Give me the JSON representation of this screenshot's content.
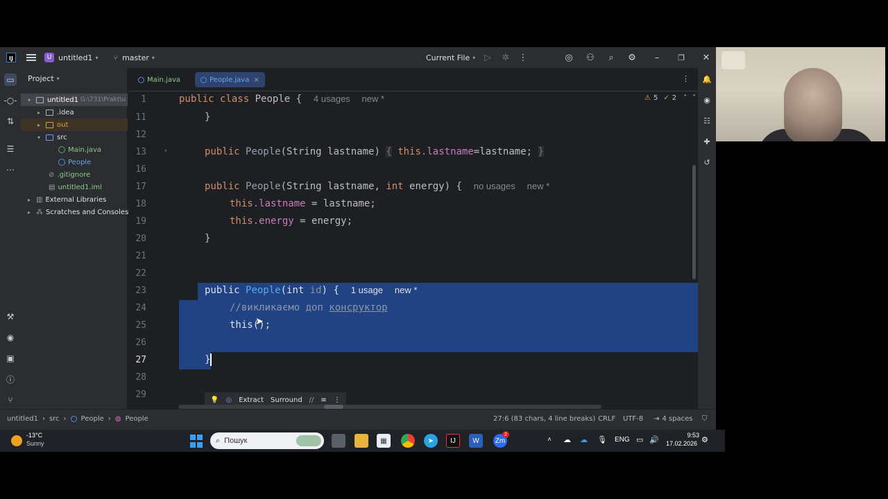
{
  "titlebar": {
    "logo": "IJ",
    "project_badge": "U",
    "project_name": "untitled1",
    "branch": "master",
    "run_config": "Current File"
  },
  "project_panel": {
    "title": "Project",
    "root": "untitled1",
    "root_path": "G:\\731\\Prakt\\u",
    "items": [
      {
        "label": ".idea"
      },
      {
        "label": "out"
      },
      {
        "label": "src"
      },
      {
        "label": "Main.java"
      },
      {
        "label": "People"
      },
      {
        "label": ".gitignore"
      },
      {
        "label": "untitled1.iml"
      },
      {
        "label": "External Libraries"
      },
      {
        "label": "Scratches and Consoles"
      }
    ]
  },
  "tabs": [
    {
      "label": "Main.java"
    },
    {
      "label": "People.java"
    }
  ],
  "inspections": {
    "warnings": "5",
    "checks": "2"
  },
  "sticky_line": {
    "num": "1",
    "kw1": "public",
    "kw2": "class",
    "name": "People {",
    "usages": "4 usages",
    "status": "new *"
  },
  "code": {
    "l11": {
      "num": "11",
      "text": "}"
    },
    "l12": {
      "num": "12"
    },
    "l13": {
      "num": "13",
      "kw": "public",
      "fn": "People",
      "params": "(String lastname)",
      "brace": "{",
      "this": "this",
      "field": ".lastname",
      "rest": "=lastname;",
      "close": "}"
    },
    "l16": {
      "num": "16"
    },
    "l17": {
      "num": "17",
      "kw": "public",
      "fn": "People",
      "params1": "(String lastname, ",
      "kw2": "int",
      "params2": " energy) {",
      "hint": "no usages",
      "status": "new *"
    },
    "l18": {
      "num": "18",
      "this": "this",
      "field": ".lastname",
      "rest": " = lastname;"
    },
    "l19": {
      "num": "19",
      "this": "this",
      "field": ".energy",
      "rest": " = energy;"
    },
    "l20": {
      "num": "20",
      "text": "}"
    },
    "l21": {
      "num": "21"
    },
    "l22": {
      "num": "22"
    },
    "l23": {
      "num": "23",
      "kw": "public",
      "fn": "People",
      "p1": "(int ",
      "param": "id",
      "p2": ") {",
      "hint": "1 usage",
      "status": "new *"
    },
    "l24": {
      "num": "24",
      "comment": "//викликаємо доп ",
      "comment2": "консруктор"
    },
    "l25": {
      "num": "25",
      "text": "this();"
    },
    "l26": {
      "num": "26"
    },
    "l27": {
      "num": "27",
      "text": "}"
    },
    "l28": {
      "num": "28"
    },
    "l29": {
      "num": "29"
    }
  },
  "popup": {
    "extract": "Extract",
    "surround": "Surround"
  },
  "statusbar": {
    "crumbs": [
      "untitled1",
      "src",
      "People",
      "People"
    ],
    "position": "27:6 (83 chars, 4 line breaks)",
    "line_sep": "CRLF",
    "encoding": "UTF-8",
    "indent": "4 spaces"
  },
  "taskbar": {
    "temp": "-13°C",
    "weather": "Sunny",
    "search": "Пошук",
    "lang": "ENG",
    "time": "9:53",
    "date": "17.02.2026",
    "badge": "2",
    "zoom": "Zm"
  }
}
